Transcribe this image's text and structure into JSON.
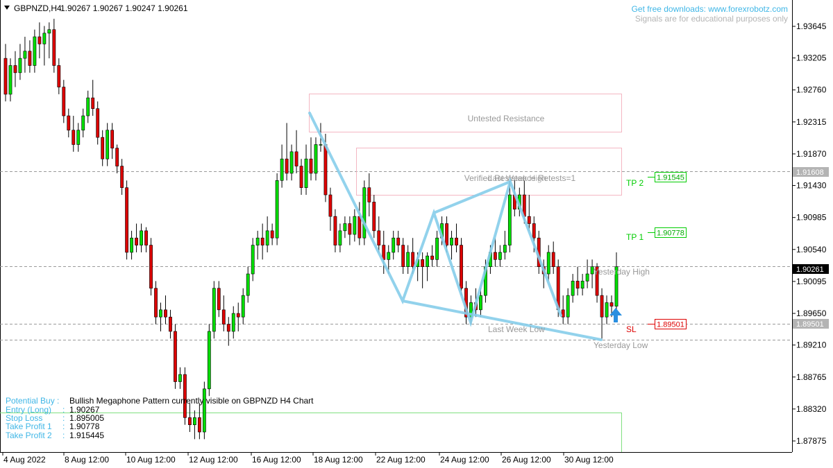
{
  "header": {
    "symbol": "GBPNZD,H4",
    "ohlc": "1.90267 1.90267 1.90247 1.90261",
    "link_text": "Get free downloads: www.forexrobotz.com",
    "disclaimer": "Signals are for educational purposes only"
  },
  "info": {
    "potential_label": "Potential Buy :",
    "potential_text": "Bullish Megaphone Pattern currently visible on GBPNZD H4 Chart",
    "entry_label": "Entry (Long)",
    "entry_value": "1.90267",
    "sl_label": "Stop Loss",
    "sl_value": "1.895005",
    "tp1_label": "Take Profit 1",
    "tp1_value": "1.90778",
    "tp2_label": "Take Profit 2",
    "tp2_value": "1.915445",
    "sep": ":"
  },
  "levels": {
    "tp2_label": "TP 2",
    "tp2_price": "1.91545",
    "tp1_label": "TP 1",
    "tp1_price": "1.90778",
    "sl_label": "SL",
    "sl_price": "1.89501",
    "line_price_a": "1.91608",
    "line_price_b": "1.89501",
    "current_price": "1.90261"
  },
  "zones": {
    "untested": "Untested Resistance",
    "verified": "Verified Resistance Retests=1",
    "last_week_high": "Last Week High",
    "last_week_low": "Last Week Low",
    "yesterday_high": "Yesterday High",
    "yesterday_low": "Yesterday Low"
  },
  "colors": {
    "bull": "#00dd00",
    "bear": "#dd0000",
    "pattern": "#87ceeb",
    "zone": "#f4b6c2",
    "tp": "#00cc00",
    "sl": "#dd0000",
    "info_label": "#3fb6e6"
  },
  "chart_data": {
    "type": "candlestick",
    "y_ticks": [
      "1.93645",
      "1.93205",
      "1.92760",
      "1.92315",
      "1.91870",
      "1.91430",
      "1.90985",
      "1.90540",
      "1.90095",
      "1.89650",
      "1.89210",
      "1.88765",
      "1.88320",
      "1.87875"
    ],
    "x_ticks": [
      "4 Aug 2022",
      "8 Aug 12:00",
      "10 Aug 12:00",
      "12 Aug 12:00",
      "16 Aug 12:00",
      "18 Aug 12:00",
      "22 Aug 12:00",
      "24 Aug 12:00",
      "26 Aug 12:00",
      "30 Aug 12:00"
    ],
    "ylim": [
      1.875,
      1.939
    ],
    "ohlc": [
      [
        1.932,
        1.934,
        1.926,
        1.927
      ],
      [
        1.927,
        1.932,
        1.926,
        1.931
      ],
      [
        1.931,
        1.933,
        1.928,
        1.93
      ],
      [
        1.93,
        1.934,
        1.929,
        1.932
      ],
      [
        1.932,
        1.935,
        1.93,
        1.933
      ],
      [
        1.933,
        1.9345,
        1.93,
        1.931
      ],
      [
        1.931,
        1.936,
        1.93,
        1.935
      ],
      [
        1.935,
        1.937,
        1.932,
        1.934
      ],
      [
        1.934,
        1.9365,
        1.931,
        1.9355
      ],
      [
        1.9355,
        1.937,
        1.932,
        1.936
      ],
      [
        1.936,
        1.9375,
        1.93,
        1.931
      ],
      [
        1.931,
        1.932,
        1.927,
        1.928
      ],
      [
        1.928,
        1.929,
        1.923,
        1.924
      ],
      [
        1.924,
        1.925,
        1.921,
        1.922
      ],
      [
        1.922,
        1.924,
        1.919,
        1.92
      ],
      [
        1.92,
        1.923,
        1.919,
        1.922
      ],
      [
        1.922,
        1.925,
        1.921,
        1.924
      ],
      [
        1.924,
        1.9275,
        1.923,
        1.9265
      ],
      [
        1.9265,
        1.929,
        1.924,
        1.925
      ],
      [
        1.925,
        1.926,
        1.92,
        1.921
      ],
      [
        1.921,
        1.922,
        1.917,
        1.918
      ],
      [
        1.918,
        1.923,
        1.917,
        1.922
      ],
      [
        1.922,
        1.923,
        1.918,
        1.9195
      ],
      [
        1.9195,
        1.92,
        1.916,
        1.917
      ],
      [
        1.917,
        1.918,
        1.913,
        1.914
      ],
      [
        1.914,
        1.915,
        1.904,
        1.905
      ],
      [
        1.905,
        1.908,
        1.904,
        1.907
      ],
      [
        1.907,
        1.909,
        1.905,
        1.906
      ],
      [
        1.906,
        1.909,
        1.905,
        1.908
      ],
      [
        1.908,
        1.9085,
        1.905,
        1.906
      ],
      [
        1.906,
        1.907,
        1.899,
        1.9
      ],
      [
        1.9,
        1.901,
        1.895,
        1.896
      ],
      [
        1.896,
        1.898,
        1.894,
        1.897
      ],
      [
        1.897,
        1.899,
        1.895,
        1.896
      ],
      [
        1.896,
        1.897,
        1.893,
        1.894
      ],
      [
        1.894,
        1.895,
        1.886,
        1.887
      ],
      [
        1.887,
        1.889,
        1.886,
        1.888
      ],
      [
        1.888,
        1.889,
        1.881,
        1.882
      ],
      [
        1.882,
        1.884,
        1.88,
        1.881
      ],
      [
        1.881,
        1.883,
        1.879,
        1.882
      ],
      [
        1.882,
        1.884,
        1.879,
        1.88
      ],
      [
        1.88,
        1.887,
        1.879,
        1.886
      ],
      [
        1.886,
        1.895,
        1.885,
        1.894
      ],
      [
        1.894,
        1.901,
        1.893,
        1.9
      ],
      [
        1.9,
        1.901,
        1.896,
        1.897
      ],
      [
        1.897,
        1.899,
        1.894,
        1.895
      ],
      [
        1.895,
        1.896,
        1.892,
        1.894
      ],
      [
        1.894,
        1.8975,
        1.893,
        1.8965
      ],
      [
        1.8965,
        1.898,
        1.894,
        1.896
      ],
      [
        1.896,
        1.9,
        1.895,
        1.899
      ],
      [
        1.899,
        1.903,
        1.898,
        1.902
      ],
      [
        1.902,
        1.907,
        1.901,
        1.906
      ],
      [
        1.906,
        1.908,
        1.904,
        1.907
      ],
      [
        1.907,
        1.909,
        1.904,
        1.906
      ],
      [
        1.906,
        1.91,
        1.905,
        1.908
      ],
      [
        1.908,
        1.909,
        1.906,
        1.907
      ],
      [
        1.907,
        1.916,
        1.906,
        1.915
      ],
      [
        1.915,
        1.92,
        1.914,
        1.918
      ],
      [
        1.918,
        1.923,
        1.915,
        1.916
      ],
      [
        1.916,
        1.92,
        1.915,
        1.919
      ],
      [
        1.919,
        1.922,
        1.916,
        1.917
      ],
      [
        1.917,
        1.918,
        1.913,
        1.914
      ],
      [
        1.914,
        1.92,
        1.913,
        1.918
      ],
      [
        1.918,
        1.921,
        1.915,
        1.916
      ],
      [
        1.916,
        1.921,
        1.915,
        1.92
      ],
      [
        1.92,
        1.923,
        1.919,
        1.92
      ],
      [
        1.92,
        1.9215,
        1.912,
        1.913
      ],
      [
        1.913,
        1.914,
        1.908,
        1.91
      ],
      [
        1.91,
        1.911,
        1.905,
        1.906
      ],
      [
        1.906,
        1.909,
        1.905,
        1.908
      ],
      [
        1.908,
        1.91,
        1.907,
        1.909
      ],
      [
        1.909,
        1.91,
        1.906,
        1.9075
      ],
      [
        1.9075,
        1.911,
        1.9065,
        1.91
      ],
      [
        1.91,
        1.912,
        1.906,
        1.907
      ],
      [
        1.907,
        1.915,
        1.906,
        1.914
      ],
      [
        1.914,
        1.916,
        1.91,
        1.912
      ],
      [
        1.912,
        1.913,
        1.907,
        1.908
      ],
      [
        1.908,
        1.91,
        1.905,
        1.906
      ],
      [
        1.906,
        1.908,
        1.902,
        1.904
      ],
      [
        1.904,
        1.906,
        1.902,
        1.905
      ],
      [
        1.905,
        1.908,
        1.904,
        1.907
      ],
      [
        1.907,
        1.908,
        1.905,
        1.906
      ],
      [
        1.906,
        1.907,
        1.902,
        1.903
      ],
      [
        1.903,
        1.906,
        1.902,
        1.905
      ],
      [
        1.905,
        1.907,
        1.902,
        1.903
      ],
      [
        1.903,
        1.905,
        1.901,
        1.904
      ],
      [
        1.904,
        1.905,
        1.9,
        1.903
      ],
      [
        1.903,
        1.905,
        1.901,
        1.9045
      ],
      [
        1.9045,
        1.906,
        1.903,
        1.904
      ],
      [
        1.904,
        1.908,
        1.903,
        1.907
      ],
      [
        1.907,
        1.91,
        1.906,
        1.909
      ],
      [
        1.909,
        1.91,
        1.905,
        1.906
      ],
      [
        1.906,
        1.908,
        1.904,
        1.907
      ],
      [
        1.907,
        1.909,
        1.905,
        1.906
      ],
      [
        1.906,
        1.907,
        1.899,
        1.9
      ],
      [
        1.9,
        1.901,
        1.895,
        1.896
      ],
      [
        1.896,
        1.899,
        1.895,
        1.898
      ],
      [
        1.898,
        1.9,
        1.896,
        1.897
      ],
      [
        1.897,
        1.9,
        1.896,
        1.899
      ],
      [
        1.899,
        1.904,
        1.898,
        1.903
      ],
      [
        1.903,
        1.906,
        1.902,
        1.905
      ],
      [
        1.905,
        1.907,
        1.903,
        1.904
      ],
      [
        1.904,
        1.906,
        1.903,
        1.905
      ],
      [
        1.905,
        1.908,
        1.904,
        1.906
      ],
      [
        1.906,
        1.915,
        1.905,
        1.913
      ],
      [
        1.913,
        1.915,
        1.91,
        1.911
      ],
      [
        1.911,
        1.914,
        1.91,
        1.913
      ],
      [
        1.913,
        1.915,
        1.909,
        1.91
      ],
      [
        1.91,
        1.913,
        1.908,
        1.909
      ],
      [
        1.909,
        1.91,
        1.905,
        1.907
      ],
      [
        1.907,
        1.908,
        1.902,
        1.903
      ],
      [
        1.903,
        1.904,
        1.9,
        1.902
      ],
      [
        1.902,
        1.906,
        1.901,
        1.905
      ],
      [
        1.905,
        1.9065,
        1.902,
        1.903
      ],
      [
        1.903,
        1.904,
        1.896,
        1.897
      ],
      [
        1.897,
        1.899,
        1.895,
        1.896
      ],
      [
        1.896,
        1.9,
        1.895,
        1.899
      ],
      [
        1.899,
        1.902,
        1.898,
        1.901
      ],
      [
        1.901,
        1.903,
        1.899,
        1.9
      ],
      [
        1.9,
        1.902,
        1.899,
        1.901
      ],
      [
        1.901,
        1.904,
        1.9,
        1.902
      ],
      [
        1.902,
        1.904,
        1.9,
        1.903
      ],
      [
        1.903,
        1.9035,
        1.898,
        1.899
      ],
      [
        1.899,
        1.9,
        1.893,
        1.896
      ],
      [
        1.896,
        1.899,
        1.895,
        1.898
      ],
      [
        1.898,
        1.899,
        1.896,
        1.8975
      ],
      [
        1.8975,
        1.905,
        1.897,
        1.903
      ]
    ],
    "pattern_points": [
      [
        1.924,
        "upper"
      ],
      [
        1.898,
        "low"
      ],
      [
        1.9103,
        "up"
      ],
      [
        1.895,
        "low"
      ],
      [
        1.915,
        "up"
      ],
      [
        1.896,
        "low"
      ],
      [
        1.8927,
        "low"
      ]
    ]
  }
}
